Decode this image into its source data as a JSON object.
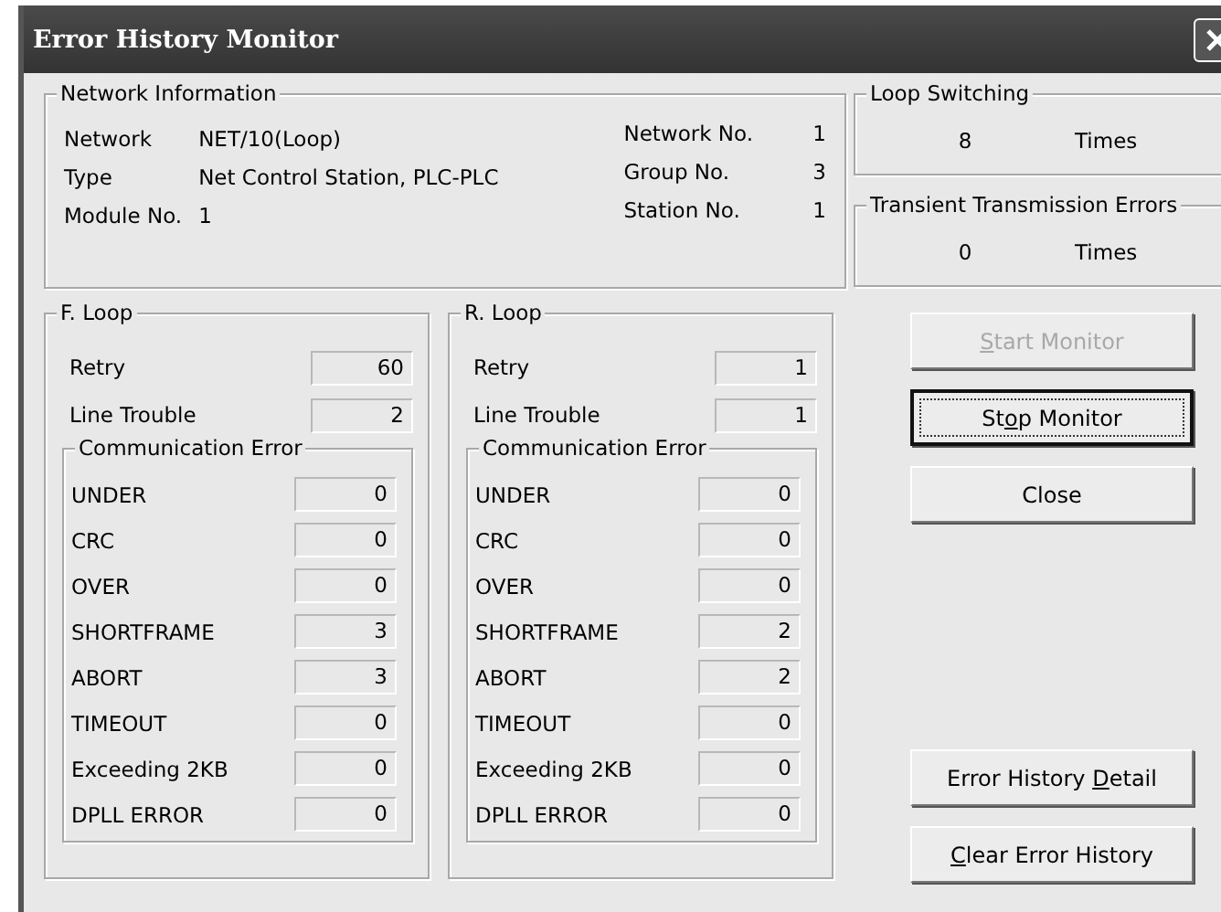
{
  "window": {
    "title": "Error History Monitor"
  },
  "network_information": {
    "title": "Network Information",
    "fields": [
      {
        "label": "Network",
        "value": "NET/10(Loop)"
      },
      {
        "label": "Type",
        "value": "Net Control Station, PLC-PLC"
      },
      {
        "label": "Module No.",
        "value": "1"
      }
    ],
    "numbers": [
      {
        "label": "Network No.",
        "value": "1"
      },
      {
        "label": "Group No.",
        "value": "3"
      },
      {
        "label": "Station No.",
        "value": "1"
      }
    ]
  },
  "loop_switching": {
    "title": "Loop Switching",
    "count": "8",
    "unit": "Times"
  },
  "transient_transmission_errors": {
    "title": "Transient Transmission Errors",
    "count": "0",
    "unit": "Times"
  },
  "loops": [
    {
      "title": "F. Loop",
      "counters": [
        {
          "label": "Retry",
          "value": "60"
        },
        {
          "label": "Line Trouble",
          "value": "2"
        }
      ],
      "communication_error": {
        "title": "Communication Error",
        "counters": [
          {
            "label": "UNDER",
            "value": "0"
          },
          {
            "label": "CRC",
            "value": "0"
          },
          {
            "label": "OVER",
            "value": "0"
          },
          {
            "label": "SHORTFRAME",
            "value": "3"
          },
          {
            "label": "ABORT",
            "value": "3"
          },
          {
            "label": "TIMEOUT",
            "value": "0"
          },
          {
            "label": "Exceeding 2KB",
            "value": "0"
          },
          {
            "label": "DPLL ERROR",
            "value": "0"
          }
        ]
      }
    },
    {
      "title": "R. Loop",
      "counters": [
        {
          "label": "Retry",
          "value": "1"
        },
        {
          "label": "Line Trouble",
          "value": "1"
        }
      ],
      "communication_error": {
        "title": "Communication Error",
        "counters": [
          {
            "label": "UNDER",
            "value": "0"
          },
          {
            "label": "CRC",
            "value": "0"
          },
          {
            "label": "OVER",
            "value": "0"
          },
          {
            "label": "SHORTFRAME",
            "value": "2"
          },
          {
            "label": "ABORT",
            "value": "2"
          },
          {
            "label": "TIMEOUT",
            "value": "0"
          },
          {
            "label": "Exceeding 2KB",
            "value": "0"
          },
          {
            "label": "DPLL ERROR",
            "value": "0"
          }
        ]
      }
    }
  ],
  "buttons_top": [
    {
      "label_parts": [
        {
          "text": "S",
          "underlined": true
        },
        {
          "text": "tart Monitor",
          "underlined": false
        }
      ],
      "disabled": true,
      "focused": false
    },
    {
      "label_parts": [
        {
          "text": "St",
          "underlined": false
        },
        {
          "text": "o",
          "underlined": true
        },
        {
          "text": "p Monitor",
          "underlined": false
        }
      ],
      "disabled": false,
      "focused": true
    },
    {
      "label_parts": [
        {
          "text": "Close",
          "underlined": false
        }
      ],
      "disabled": false,
      "focused": false
    }
  ],
  "buttons_bottom": [
    {
      "label_parts": [
        {
          "text": "Error History ",
          "underlined": false
        },
        {
          "text": "D",
          "underlined": true
        },
        {
          "text": "etail",
          "underlined": false
        }
      ],
      "disabled": false,
      "focused": false
    },
    {
      "label_parts": [
        {
          "text": "C",
          "underlined": true
        },
        {
          "text": "lear Error History",
          "underlined": false
        }
      ],
      "disabled": false,
      "focused": false
    }
  ]
}
